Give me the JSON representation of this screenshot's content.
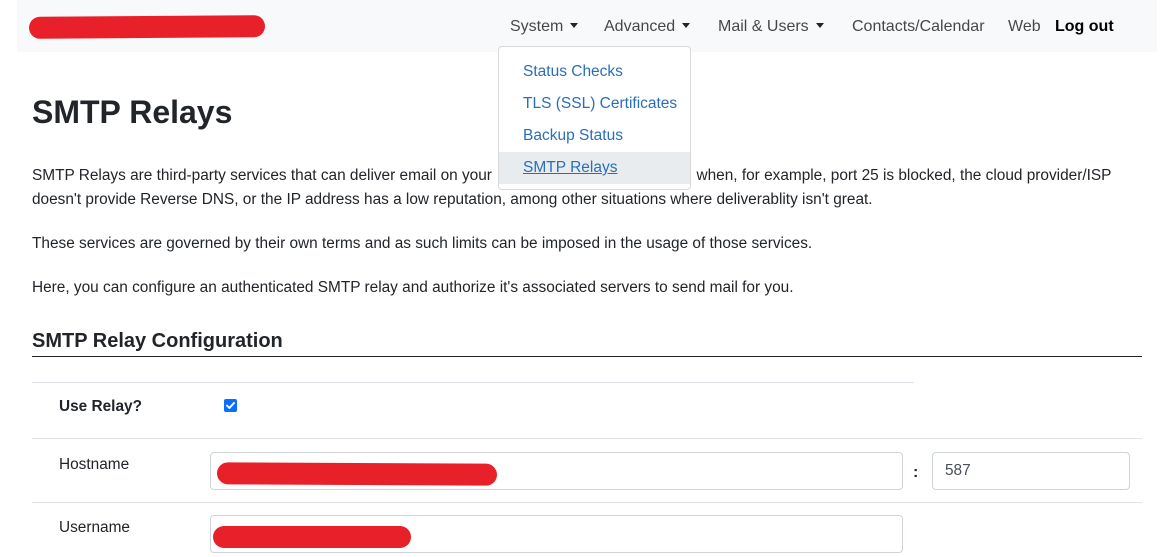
{
  "navbar": {
    "items": [
      {
        "label": "System",
        "has_caret": true
      },
      {
        "label": "Advanced",
        "has_caret": true
      },
      {
        "label": "Mail & Users",
        "has_caret": true
      },
      {
        "label": "Contacts/Calendar",
        "has_caret": false
      },
      {
        "label": "Web",
        "has_caret": false
      },
      {
        "label": "Log out",
        "has_caret": false
      }
    ]
  },
  "dropdown": {
    "items": [
      {
        "label": "Status Checks"
      },
      {
        "label": "TLS (SSL) Certificates"
      },
      {
        "label": "Backup Status"
      },
      {
        "label": "SMTP Relays",
        "active": true
      }
    ]
  },
  "page": {
    "title": "SMTP Relays",
    "intro_before": "SMTP Relays are third-party services that can deliver email on your",
    "intro_after": "when, for example, port 25 is blocked, the cloud provider/ISP doesn't provide Reverse DNS, or the IP address has a low reputation, among other situations where deliverablity isn't great.",
    "para2": "These services are governed by their own terms and as such limits can be imposed in the usage of those services.",
    "para3": "Here, you can configure an authenticated SMTP relay and authorize it's associated servers to send mail for you."
  },
  "config": {
    "heading": "SMTP Relay Configuration",
    "use_relay_label": "Use Relay?",
    "use_relay_checked": true,
    "hostname_label": "Hostname",
    "port_separator": ":",
    "port_value": "587",
    "username_label": "Username"
  },
  "colors": {
    "link": "#2a6ebb",
    "checkbox": "#0d6efd",
    "redaction": "#e8202a"
  }
}
